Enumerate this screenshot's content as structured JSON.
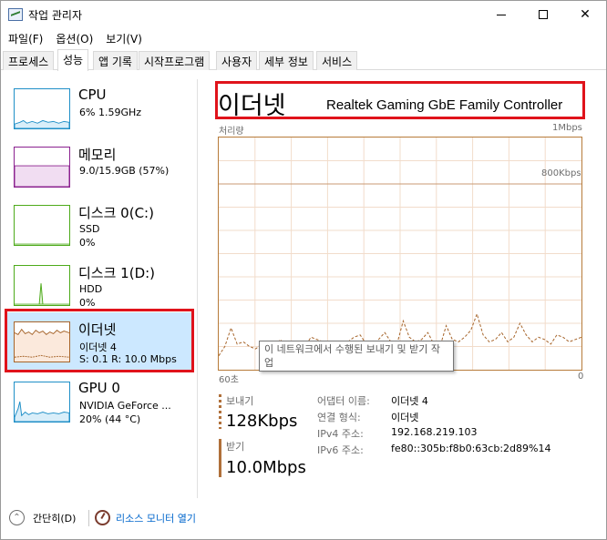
{
  "window": {
    "title": "작업 관리자"
  },
  "menu": [
    "파일(F)",
    "옵션(O)",
    "보기(V)"
  ],
  "tabs": [
    "프로세스",
    "성능",
    "앱 기록",
    "시작프로그램",
    "사용자",
    "세부 정보",
    "서비스"
  ],
  "active_tab": "성능",
  "sidebar": {
    "items": [
      {
        "title": "CPU",
        "line1": "6% 1.59GHz",
        "line2": "",
        "color": "#1f8fc7"
      },
      {
        "title": "메모리",
        "line1": "9.0/15.9GB (57%)",
        "line2": "",
        "color": "#8b218f"
      },
      {
        "title": "디스크 0(C:)",
        "line1": "SSD",
        "line2": "0%",
        "color": "#4daa1a"
      },
      {
        "title": "디스크 1(D:)",
        "line1": "HDD",
        "line2": "0%",
        "color": "#4daa1a"
      },
      {
        "title": "이더넷",
        "line1": "이더넷 4",
        "line2": "S: 0.1  R: 10.0 Mbps",
        "color": "#a6642a"
      },
      {
        "title": "GPU 0",
        "line1": "NVIDIA GeForce ...",
        "line2": "20% (44 °C)",
        "color": "#1f8fc7"
      }
    ],
    "selected_index": 4
  },
  "main": {
    "heading": "이더넷",
    "adapter_name": "Realtek Gaming GbE Family Controller",
    "chart_title": "처리량",
    "chart_max": "1Mbps",
    "chart_ref_line": "800Kbps",
    "chart_time": "60초",
    "chart_zero": "0",
    "tooltip": "이 네트워크에서 수행된 보내기 및 받기 작업"
  },
  "stats": {
    "send_label": "보내기",
    "send_value": "128Kbps",
    "recv_label": "받기",
    "recv_value": "10.0Mbps"
  },
  "properties": [
    {
      "key": "어댑터 이름:",
      "value": "이더넷 4"
    },
    {
      "key": "연결 형식:",
      "value": "이더넷"
    },
    {
      "key": "IPv4 주소:",
      "value": "192.168.219.103"
    },
    {
      "key": "IPv6 주소:",
      "value": "fe80::305b:f8b0:63cb:2d89%14"
    }
  ],
  "footer": {
    "collapse_label": "간단히(D)",
    "monitor_link": "리소스 모니터 열기"
  },
  "colors": {
    "accent": "#a6642a",
    "selection": "#cce8ff",
    "highlight": "#e0131b",
    "link": "#0066cc"
  },
  "chart_data": {
    "type": "line",
    "title": "처리량",
    "y_max_label": "1Mbps",
    "ref_line_label": "800Kbps",
    "x_label": "60초",
    "x_end_label": "0",
    "series": [
      {
        "values": [
          0.06,
          0.1,
          0.18,
          0.11,
          0.12,
          0.1,
          0.09,
          0.11,
          0.12,
          0.09,
          0.13,
          0.1,
          0.12,
          0.11,
          0.1,
          0.14,
          0.13,
          0.12,
          0.11,
          0.09,
          0.1,
          0.12,
          0.14,
          0.15,
          0.11,
          0.1,
          0.13,
          0.16,
          0.12,
          0.11,
          0.21,
          0.14,
          0.12,
          0.13,
          0.16,
          0.11,
          0.1,
          0.19,
          0.13,
          0.12,
          0.14,
          0.17,
          0.24,
          0.15,
          0.12,
          0.13,
          0.16,
          0.12,
          0.14,
          0.2,
          0.15,
          0.12,
          0.14,
          0.13,
          0.11,
          0.15,
          0.14,
          0.12,
          0.13,
          0.14
        ]
      }
    ]
  }
}
